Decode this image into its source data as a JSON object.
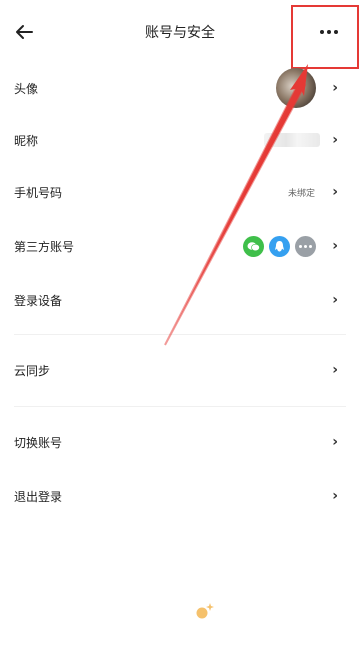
{
  "header": {
    "title": "账号与安全",
    "back_icon": "back-arrow-icon",
    "more_icon": "more-dots-icon"
  },
  "rows": {
    "avatar": {
      "label": "头像"
    },
    "nickname": {
      "label": "昵称"
    },
    "phone": {
      "label": "手机号码",
      "value": "未绑定"
    },
    "third_party": {
      "label": "第三方账号",
      "icons": [
        "wechat-icon",
        "qq-icon",
        "more-icon"
      ]
    },
    "devices": {
      "label": "登录设备"
    },
    "sync": {
      "label": "云同步"
    },
    "switch_account": {
      "label": "切换账号"
    },
    "logout": {
      "label": "退出登录"
    }
  },
  "chevron": "›",
  "annotation": {
    "color": "#e53935"
  }
}
